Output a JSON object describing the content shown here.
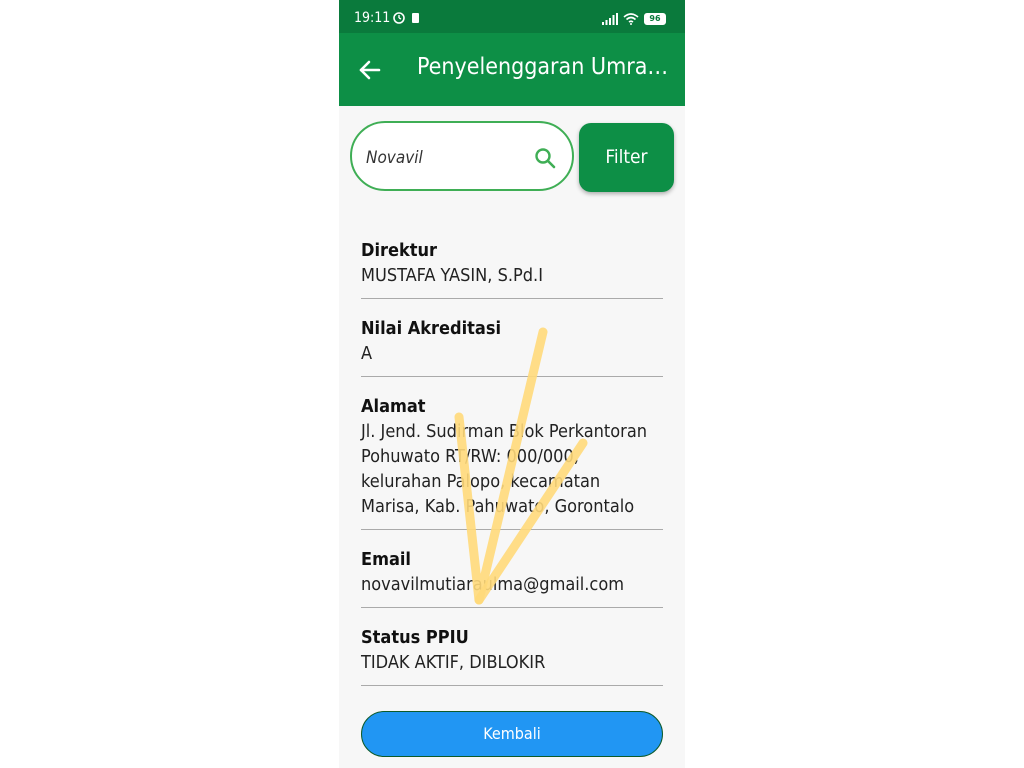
{
  "status_bar": {
    "time": "19:11",
    "battery": "96"
  },
  "app_bar": {
    "title": "Penyelenggaran Umrah...",
    "back_icon": "arrow-left-icon"
  },
  "search": {
    "value": "Novavil",
    "icon": "search-icon"
  },
  "filter_button": {
    "label": "Filter"
  },
  "fields": [
    {
      "label": "Direktur",
      "value": "MUSTAFA YASIN, S.Pd.I"
    },
    {
      "label": "Nilai Akreditasi",
      "value": "A"
    },
    {
      "label": "Alamat",
      "value": "Jl. Jend. Sudirman Blok Perkantoran Pohuwato RT/RW: 000/000, kelurahan Palopo, kecamatan Marisa, Kab. Pahuwato, Gorontalo"
    },
    {
      "label": "Email",
      "value": "novavilmutiaraulma@gmail.com"
    },
    {
      "label": "Status PPIU",
      "value": "TIDAK AKTIF, DIBLOKIR"
    }
  ],
  "back_button": {
    "label": "Kembali"
  },
  "colors": {
    "primary_green": "#0d8f46",
    "status_green": "#0a7a3c",
    "button_blue": "#2196f3",
    "scribble_yellow": "#ffd97a"
  }
}
